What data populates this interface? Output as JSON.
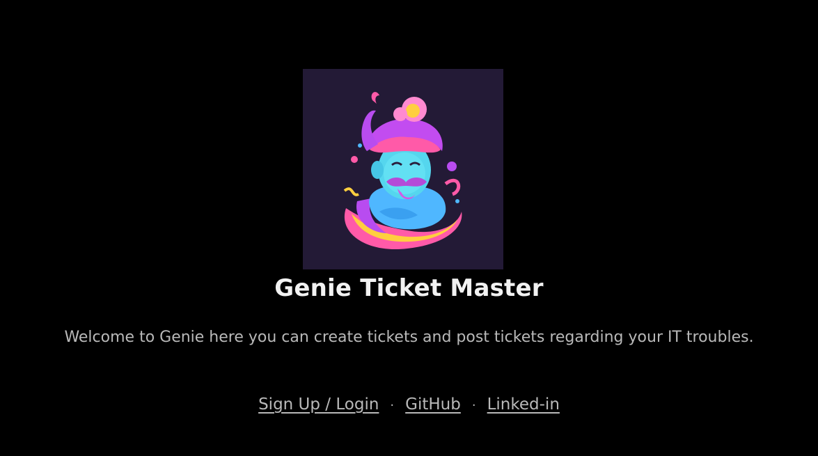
{
  "hero": {
    "logo": "genie-logo",
    "title": "Genie Ticket Master",
    "welcome": "Welcome to Genie here you can create tickets and post tickets regarding your IT troubles."
  },
  "links": {
    "signup_login": "Sign Up / Login",
    "github": "GitHub",
    "linkedin": "Linked-in",
    "separator": "·"
  },
  "colors": {
    "background": "#000000",
    "logo_background": "#231a36",
    "title": "#f2f2f2",
    "text": "#b9b9b9"
  }
}
